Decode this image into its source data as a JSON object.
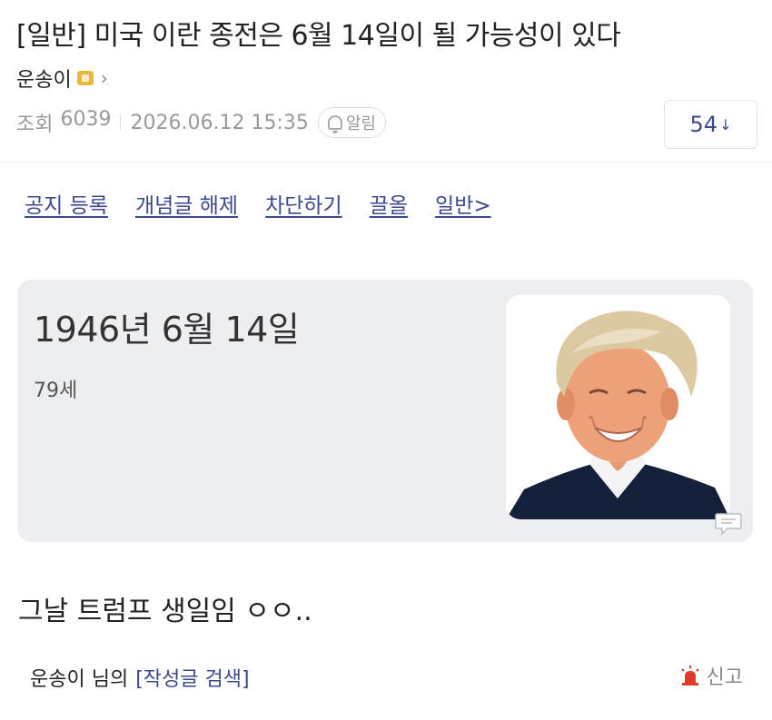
{
  "post": {
    "title": "[일반] 미국 이란 종전은 6월 14일이 될 가능성이 있다",
    "author": "운송이",
    "views_label": "조회",
    "views_count": "6039",
    "datetime": "2026.06.12 15:35",
    "alarm_label": "알림",
    "comment_count": "54",
    "comment_arrow": "↓",
    "body_text": "그날 트럼프 생일임 ㅇㅇ.."
  },
  "actions": [
    "공지 등록",
    "개념글 해제",
    "차단하기",
    "끌올",
    "일반>"
  ],
  "card": {
    "date": "1946년 6월 14일",
    "age": "79세"
  },
  "footer": {
    "author_suffix": "운송이 님의",
    "search_link": "[작성글 검색]",
    "report_label": "신고"
  },
  "colors": {
    "accent": "#3b4890",
    "meta": "#999999",
    "card_bg": "#edeef1",
    "report_red": "#e0392b"
  },
  "icons": {
    "badge": "gallery-badge-icon",
    "chevron": "chevron-right-icon",
    "alarm": "bell-icon",
    "speech": "speech-bubble-icon",
    "report": "siren-icon"
  }
}
